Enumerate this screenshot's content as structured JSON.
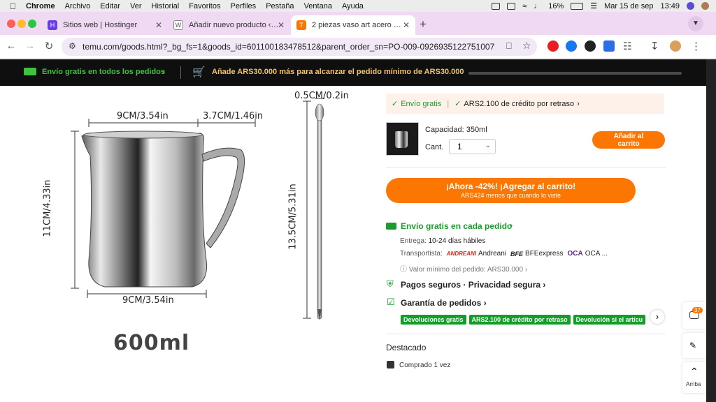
{
  "mac_menu": {
    "app": "Chrome",
    "items": [
      "Archivo",
      "Editar",
      "Ver",
      "Historial",
      "Favoritos",
      "Perfiles",
      "Pestaña",
      "Ventana",
      "Ayuda"
    ],
    "battery": "16%",
    "date": "Mar 15 de sep",
    "time": "13:49"
  },
  "tabs": [
    {
      "title": "Sitios web | Hostinger",
      "favicon_color": "#673de6"
    },
    {
      "title": "Añadir nuevo producto ‹ — W",
      "favicon_color": "#888888"
    },
    {
      "title": "2 piezas vaso art acero inoxid",
      "favicon_color": "#fb7701"
    }
  ],
  "address": {
    "url": "temu.com/goods.html?_bg_fs=1&goods_id=601100183478512&parent_order_sn=PO-009-09269351227510079&_oak_..."
  },
  "promo": {
    "free_shipping": "Envío gratis en todos los pedidos",
    "minimum": "Añade ARS30.000 más para alcanzar el pedido mínimo de ARS30.000"
  },
  "product_image": {
    "top_width": "9CM/3.54in",
    "handle_width": "3.7CM/1.46in",
    "height": "11CM/4.33in",
    "bottom_width": "9CM/3.54in",
    "spoon_width": "0.5CM/0.2in",
    "spoon_length": "13.5CM/5.31in",
    "capacity": "600ml"
  },
  "panel": {
    "free_shipping": "Envío gratis",
    "credit": "ARS2.100 de crédito por retraso",
    "capacity": "Capacidad: 350ml",
    "qty_label": "Cant.",
    "qty_value": "1",
    "add_cart": "Añadir al carrito",
    "deal_title": "¡Ahora -42%! ¡Agregar al carrito!",
    "deal_sub": "ARS424 menos que cuando lo viste",
    "ship_title": "Envío gratis en cada pedido",
    "delivery_label": "Entrega:",
    "delivery_value": "10-24 días hábiles",
    "carrier_label": "Transportista:",
    "carrier_logo_1": "ANDREANI",
    "carrier_1": "Andreani",
    "carrier_logo_2": "BFE",
    "carrier_2": "BFEexpress",
    "carrier_logo_3": "OCA",
    "carrier_3": "OCA ...",
    "min_order": "Valor mínimo del pedido: ARS30.000",
    "secure": "Pagos seguros · Privacidad segura",
    "guarantee": "Garantía de pedidos",
    "pills": [
      "Devoluciones gratis",
      "ARS2.100 de crédito por retraso",
      "Devolución si el artícu"
    ],
    "featured": "Destacado",
    "bought": "Comprado 1 vez"
  },
  "side": {
    "badge": "37",
    "top_label": "Arriba"
  },
  "colors": {
    "accent": "#fb7701",
    "green": "#1c9b2f",
    "tabstrip": "#efd9f3"
  }
}
